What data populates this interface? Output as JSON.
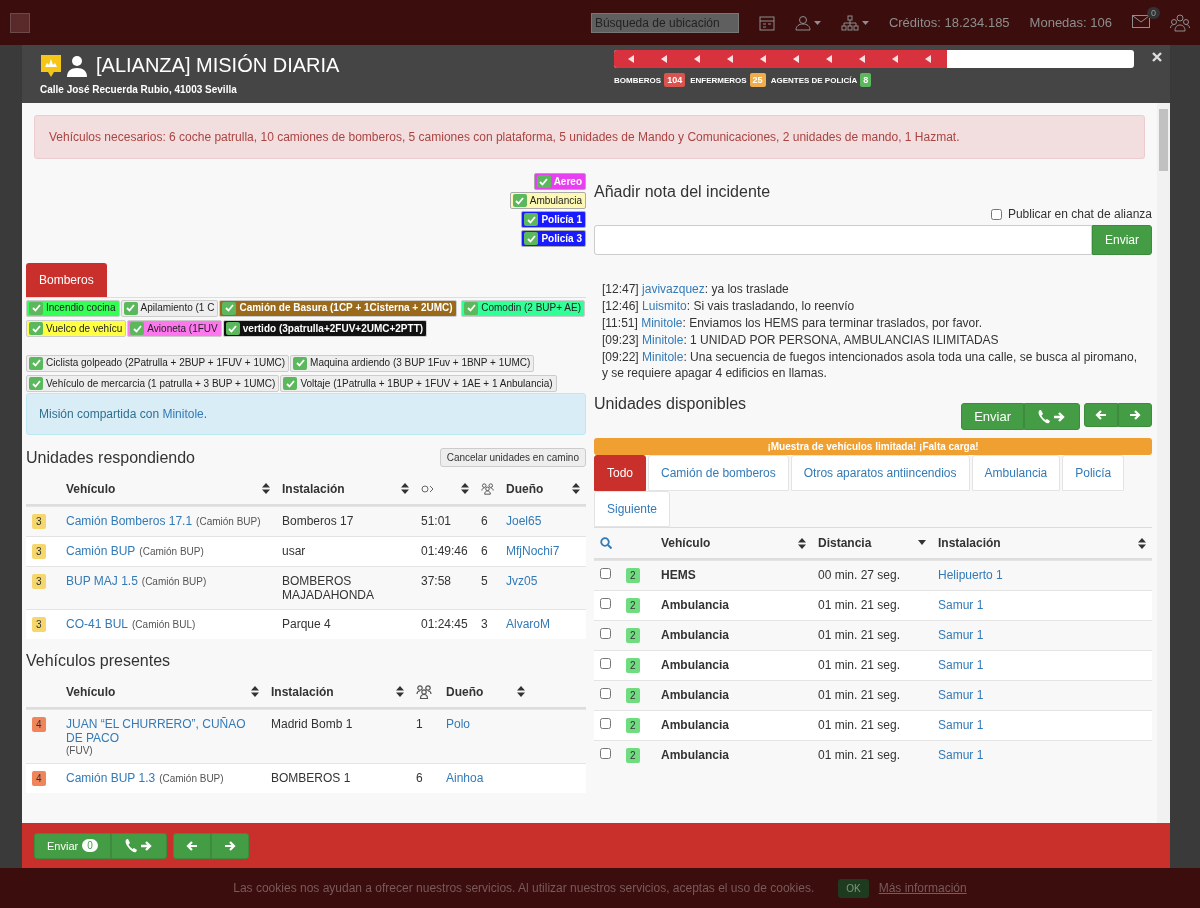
{
  "topbar": {
    "search_placeholder": "Búsqueda de ubicación",
    "credits": "Créditos: 18.234.185",
    "coins": "Monedas: 106",
    "mail_count": "0"
  },
  "mission": {
    "title": "[ALIANZA] MISIÓN DIARIA",
    "address": "Calle José Recuerda Rubio, 41003 Sevilla",
    "progress": {
      "level": 0.64
    },
    "personnel": [
      {
        "label": "BOMBEROS",
        "count": "104",
        "color": "#d9534f"
      },
      {
        "label": "ENFERMEROS",
        "count": "25",
        "color": "#f0ad4e"
      },
      {
        "label": "AGENTES DE POLICÍA",
        "count": "8",
        "color": "#5cb85c"
      }
    ]
  },
  "requirements": "Vehículos necesarios: 6 coche patrulla, 10 camiones de bomberos, 5 camiones con plataforma, 5 unidades de Mando y Comunicaciones, 2 unidades de mando, 1 Hazmat.",
  "filter_tags": [
    {
      "label": "Aereo",
      "color": "#e83ff0",
      "checked": true
    },
    {
      "label": "Ambulancia",
      "color": "#fdf9b4",
      "checked": true
    },
    {
      "label": "Policía 1",
      "color": "#1a1aff",
      "checked": true
    },
    {
      "label": "Policía 3",
      "color": "#1a1aff",
      "checked": true
    }
  ],
  "category_tabs": [
    {
      "label": "Bomberos",
      "selected": true
    }
  ],
  "mission_tag_rows": [
    {
      "tags": [
        {
          "label": "Incendio cocina",
          "color": "#33ff55",
          "checked": true
        },
        {
          "label": "Apilamiento (1 C",
          "color": "#eeeeee",
          "checked": true
        },
        {
          "label": "Camión de Basura (1CP + 1Cisterna + 2UMC)",
          "color": "#9a6a1a",
          "checked": true
        },
        {
          "label": "Comodin (2 BUP+ AE)",
          "color": "#33ff99",
          "checked": true
        }
      ]
    },
    {
      "tags": [
        {
          "label": "Vuelco de vehícu",
          "color": "#ffff44",
          "checked": true
        },
        {
          "label": "Avioneta (1FUV",
          "color": "#ff77ee",
          "checked": true
        },
        {
          "label": "vertido (3patrulla+2FUV+2UMC+2PTT)",
          "color": "#111111",
          "checked": true
        }
      ]
    },
    {
      "tags": [
        {
          "label": "Ciclista golpeado (2Patrulla + 2BUP + 1FUV + 1UMC)",
          "color": "#eeeeee",
          "checked": true
        },
        {
          "label": "Maquina ardiendo (3 BUP 1Fuv + 1BNP + 1UMC)",
          "color": "#eeeeee",
          "checked": true
        }
      ]
    },
    {
      "tags": [
        {
          "label": "Vehículo de mercarcia (1 patrulla + 3 BUP + 1UMC)",
          "color": "#eeeeee",
          "checked": true
        },
        {
          "label": "Voltaje (1Patrulla + 1BUP + 1FUV + 1AE + 1 Anbulancia)",
          "color": "#eeeeee",
          "checked": true
        }
      ]
    }
  ],
  "shared": {
    "text": "Misión compartida con ",
    "user": "Minitole",
    "end": "."
  },
  "responding": {
    "title": "Unidades respondiendo",
    "cancel_button": "Cancelar unidades en camino",
    "columns": [
      {
        "label": "Vehículo"
      },
      {
        "label": "Instalación"
      },
      {
        "label": "Dueño"
      }
    ],
    "rows": [
      {
        "badge": "3",
        "color": "#f5d76e",
        "vehicle": "Camión Bomberos 17.1",
        "type": "(Camión BUP)",
        "station": "Bomberos 17",
        "time": "51:01",
        "crew": "6",
        "owner": "Joel65"
      },
      {
        "badge": "3",
        "color": "#f5d76e",
        "vehicle": "Camión BUP",
        "type": "(Camión BUP)",
        "station": "usar",
        "time": "01:49:46",
        "crew": "6",
        "owner": "MfjNochi7"
      },
      {
        "badge": "3",
        "color": "#f5d76e",
        "vehicle": "BUP MAJ 1.5",
        "type": "(Camión BUP)",
        "station": "BOMBEROS MAJADAHONDA",
        "time": "37:58",
        "crew": "5",
        "owner": "Jvz05"
      },
      {
        "badge": "3",
        "color": "#f5d76e",
        "vehicle": "CO-41 BUL",
        "type": "(Camión BUL)",
        "station": "Parque 4",
        "time": "01:24:45",
        "crew": "3",
        "owner": "AlvaroM"
      }
    ]
  },
  "present": {
    "title": "Vehículos presentes",
    "columns": [
      {
        "label": "Vehículo"
      },
      {
        "label": "Instalación"
      },
      {
        "label": "Dueño"
      }
    ],
    "rows": [
      {
        "badge": "4",
        "color": "#f0855a",
        "vehicle": "JUAN “EL CHURRERO”, CUÑAO DE PACO",
        "type": "(FUV)",
        "station": "Madrid Bomb 1",
        "crew": "1",
        "owner": "Polo"
      },
      {
        "badge": "4",
        "color": "#f0855a",
        "vehicle": "Camión BUP 1.3",
        "type": "(Camión BUP)",
        "station": "BOMBEROS 1",
        "crew": "6",
        "owner": "Ainhoa"
      }
    ]
  },
  "note": {
    "title": "Añadir nota del incidente",
    "publish_label": "Publicar en chat de alianza",
    "publish_checked": false,
    "send_button": "Enviar"
  },
  "chat": [
    {
      "time": "[12:47]",
      "user": "javivazquez",
      "text": ": ya los traslade"
    },
    {
      "time": "[12:46]",
      "user": "Luismito",
      "text": ": Si vais trasladando, lo reenvío"
    },
    {
      "time": "[11:51]",
      "user": "Minitole",
      "text": ": Enviamos los HEMS para terminar traslados, por favor."
    },
    {
      "time": "[09:23]",
      "user": "Minitole",
      "text": ": 1 UNIDAD POR PERSONA, AMBULANCIAS ILIMITADAS"
    },
    {
      "time": "[09:22]",
      "user": "Minitole",
      "text": ": Una secuencia de fuegos intencionados asola toda una calle, se busca al piromano, y se requiere apagar 4 edificios en llamas."
    }
  ],
  "available": {
    "title": "Unidades disponibles",
    "send_button": "Enviar",
    "warning": "¡Muestra de vehículos limitada! ¡Falta carga!",
    "tabs": [
      {
        "label": "Todo",
        "selected": true
      },
      {
        "label": "Camión de bomberos",
        "selected": false
      },
      {
        "label": "Otros aparatos antiincendios",
        "selected": false
      },
      {
        "label": "Ambulancia",
        "selected": false
      },
      {
        "label": "Policía",
        "selected": false
      },
      {
        "label": "Siguiente",
        "selected": false
      }
    ],
    "columns": [
      {
        "label": "Vehículo",
        "sorted_desc": false
      },
      {
        "label": "Distancia",
        "sorted_desc": true
      },
      {
        "label": "Instalación",
        "sorted_desc": false
      }
    ],
    "rows": [
      {
        "checked": false,
        "badge": "2",
        "color": "#6fdc7f",
        "vehicle": "HEMS",
        "distance": "00 min. 27 seg.",
        "station": "Helipuerto 1"
      },
      {
        "checked": false,
        "badge": "2",
        "color": "#6fdc7f",
        "vehicle": "Ambulancia",
        "distance": "01 min. 21 seg.",
        "station": "Samur 1"
      },
      {
        "checked": false,
        "badge": "2",
        "color": "#6fdc7f",
        "vehicle": "Ambulancia",
        "distance": "01 min. 21 seg.",
        "station": "Samur 1"
      },
      {
        "checked": false,
        "badge": "2",
        "color": "#6fdc7f",
        "vehicle": "Ambulancia",
        "distance": "01 min. 21 seg.",
        "station": "Samur 1"
      },
      {
        "checked": false,
        "badge": "2",
        "color": "#6fdc7f",
        "vehicle": "Ambulancia",
        "distance": "01 min. 21 seg.",
        "station": "Samur 1"
      },
      {
        "checked": false,
        "badge": "2",
        "color": "#6fdc7f",
        "vehicle": "Ambulancia",
        "distance": "01 min. 21 seg.",
        "station": "Samur 1"
      },
      {
        "checked": false,
        "badge": "2",
        "color": "#6fdc7f",
        "vehicle": "Ambulancia",
        "distance": "01 min. 21 seg.",
        "station": "Samur 1"
      }
    ]
  },
  "footer": {
    "send_button": "Enviar",
    "count": "0"
  },
  "cookies": {
    "text": "Las cookies nos ayudan a ofrecer nuestros servicios. Al utilizar nuestros servicios, aceptas el uso de cookies.",
    "ok": "OK",
    "more": "Más información"
  }
}
